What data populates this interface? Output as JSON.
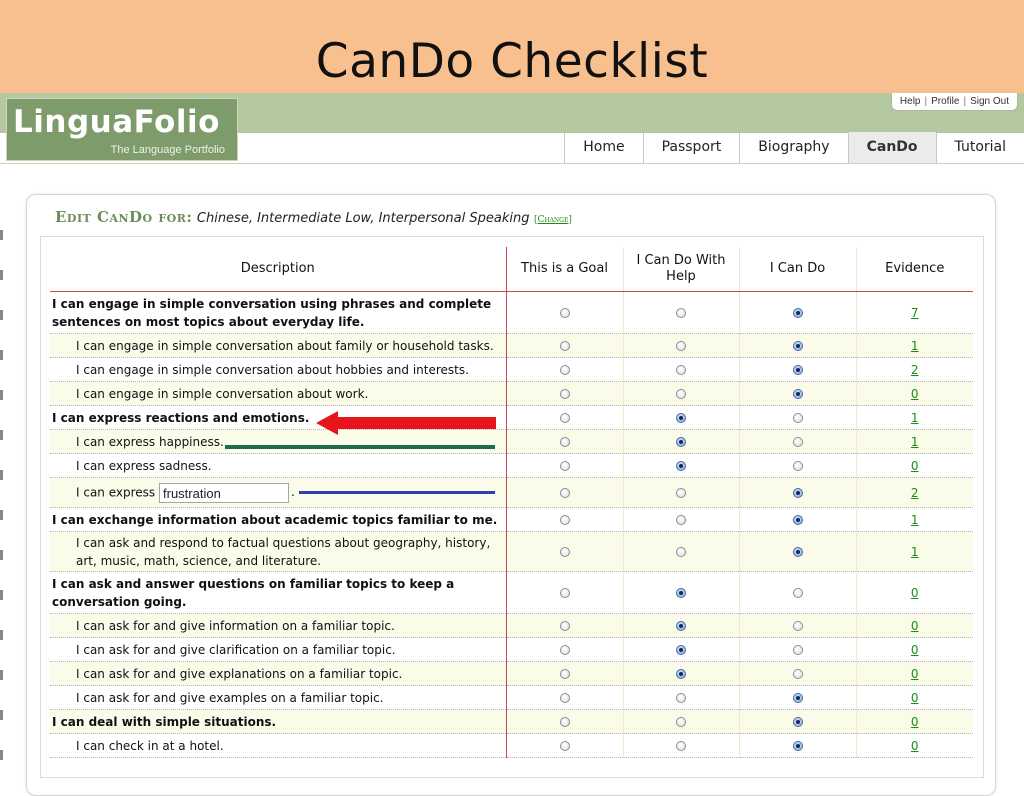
{
  "slide": {
    "title": "CanDo Checklist"
  },
  "header": {
    "logo_main": "LinguaFolio",
    "logo_sub": "The Language Portfolio",
    "util_links": [
      "Help",
      "Profile",
      "Sign Out"
    ],
    "nav_tabs": [
      {
        "label": "Home",
        "active": false
      },
      {
        "label": "Passport",
        "active": false
      },
      {
        "label": "Biography",
        "active": false
      },
      {
        "label": "CanDo",
        "active": true
      },
      {
        "label": "Tutorial",
        "active": false
      }
    ]
  },
  "edit": {
    "label": "Edit CanDo for:",
    "value": "Chinese, Intermediate Low, Interpersonal Speaking",
    "change_open": "[",
    "change_label": "Change",
    "change_close": "]"
  },
  "table": {
    "columns": [
      "Description",
      "This is a Goal",
      "I Can Do With Help",
      "I Can Do",
      "Evidence"
    ],
    "rows": [
      {
        "type": "main",
        "text": "I can engage in simple conversation using phrases and complete sentences on most topics about everyday life.",
        "selected": 2,
        "evidence": "7"
      },
      {
        "type": "sub",
        "text": "I can engage in simple conversation about family or household tasks.",
        "selected": 2,
        "evidence": "1"
      },
      {
        "type": "sub",
        "text": "I can engage in simple conversation about hobbies and interests.",
        "selected": 2,
        "evidence": "2"
      },
      {
        "type": "sub",
        "text": "I can engage in simple conversation about work.",
        "selected": 2,
        "evidence": "0"
      },
      {
        "type": "main",
        "text": "I can express reactions and emotions.",
        "selected": 1,
        "evidence": "1"
      },
      {
        "type": "sub",
        "text": "I can express happiness.",
        "selected": 1,
        "evidence": "1"
      },
      {
        "type": "sub",
        "text": "I can express sadness.",
        "selected": 1,
        "evidence": "0"
      },
      {
        "type": "input",
        "text": "I can express",
        "input_value": "frustration",
        "after": ".",
        "selected": 2,
        "evidence": "2"
      },
      {
        "type": "main",
        "text": "I can exchange information about academic topics familiar to me.",
        "selected": 2,
        "evidence": "1"
      },
      {
        "type": "sub",
        "text": "I can ask and respond to factual questions about geography, history, art, music, math, science, and literature.",
        "selected": 2,
        "evidence": "1"
      },
      {
        "type": "main",
        "text": "I can ask and answer questions on familiar topics to keep a conversation going.",
        "selected": 1,
        "evidence": "0"
      },
      {
        "type": "sub",
        "text": "I can ask for and give information on a familiar topic.",
        "selected": 1,
        "evidence": "0"
      },
      {
        "type": "sub",
        "text": "I can ask for and give clarification on a familiar topic.",
        "selected": 1,
        "evidence": "0"
      },
      {
        "type": "sub",
        "text": "I can ask for and give explanations on a familiar topic.",
        "selected": 1,
        "evidence": "0"
      },
      {
        "type": "sub",
        "text": "I can ask for and give examples on a familiar topic.",
        "selected": 2,
        "evidence": "0"
      },
      {
        "type": "main",
        "text": "I can deal with simple situations.",
        "selected": 2,
        "evidence": "0"
      },
      {
        "type": "sub",
        "text": "I can check in at a hotel.",
        "selected": 2,
        "evidence": "0"
      }
    ]
  },
  "annotations": {
    "red_arrow_color": "#e8141b",
    "green_line_color": "#1f6b4a",
    "blue_line_color": "#2d3fb8"
  }
}
